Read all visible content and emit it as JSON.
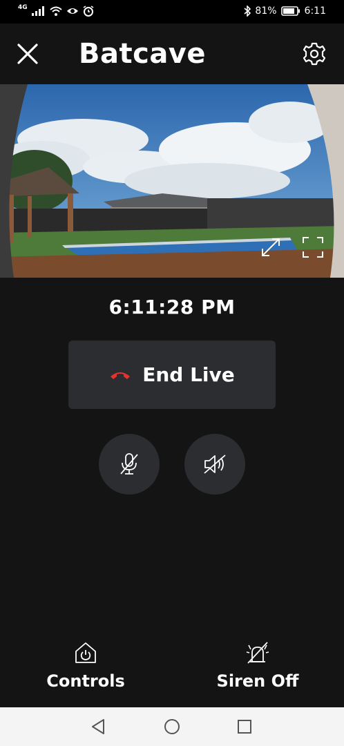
{
  "status_bar": {
    "network": "4G",
    "battery_percent": "81%",
    "time": "6:11",
    "icons": [
      "signal-icon",
      "wifi-icon",
      "eye-icon",
      "alarm-icon",
      "bluetooth-icon",
      "battery-icon"
    ]
  },
  "header": {
    "title": "Batcave",
    "close_icon": "close-icon",
    "settings_icon": "gear-icon"
  },
  "camera": {
    "expand_icon": "expand-icon",
    "fullscreen_icon": "fullscreen-icon"
  },
  "live": {
    "timestamp": "6:11:28 PM",
    "end_live_label": "End Live",
    "end_icon": "hang-up-icon",
    "end_icon_color": "#e5322d"
  },
  "toggles": {
    "mic_icon": "mic-muted-icon",
    "speaker_icon": "speaker-muted-icon"
  },
  "actions": {
    "controls_label": "Controls",
    "controls_icon": "home-power-icon",
    "siren_label": "Siren Off",
    "siren_icon": "siren-off-icon"
  },
  "nav": {
    "icons": [
      "back-icon",
      "home-icon",
      "recents-icon"
    ]
  },
  "colors": {
    "background": "#141414",
    "button_bg": "#2b2d31",
    "nav_bg": "#f4f4f4"
  }
}
